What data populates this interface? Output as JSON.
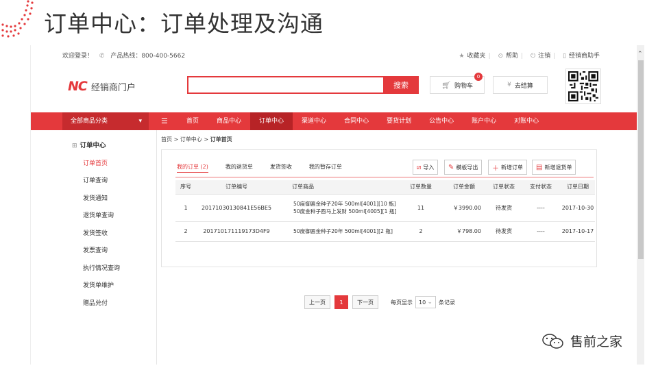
{
  "slide": {
    "title": "订单中心：订单处理及沟通"
  },
  "topbar": {
    "welcome": "欢迎登录！",
    "hotline": "产品热线：800-400-5662",
    "links": [
      "收藏夹",
      "帮助",
      "注销",
      "经销商助手"
    ]
  },
  "header": {
    "logo_mark": "NC",
    "logo_text": "经销商门户",
    "search_placeholder": "",
    "search_button": "搜索",
    "cart_label": "购物车",
    "cart_count": "0",
    "checkout_label": "去结算"
  },
  "nav": {
    "all_categories": "全部商品分类",
    "items": [
      "首页",
      "商品中心",
      "订单中心",
      "渠道中心",
      "合同中心",
      "要货计划",
      "公告中心",
      "账户中心",
      "对账中心"
    ],
    "active_index": 2
  },
  "sidebar": {
    "title": "订单中心",
    "items": [
      "订单首页",
      "订单查询",
      "发货通知",
      "退货单查询",
      "发货签收",
      "发票查询",
      "执行情况查询",
      "发货单维护",
      "赠品兑付"
    ],
    "active_index": 0
  },
  "breadcrumb": {
    "path": "首页 > 订单中心 > ",
    "current": "订单首页"
  },
  "tabs": [
    "我的订单 (2)",
    "我的退货单",
    "发货签收",
    "我的暂存订单"
  ],
  "toolbar": {
    "import": "导入",
    "template_export": "模板导出",
    "add_order": "新增订单",
    "add_return": "新增退货单"
  },
  "table": {
    "headers": [
      "序号",
      "订单编号",
      "订单商品",
      "订单数量",
      "订单金额",
      "订单状态",
      "支付状态",
      "订单日期"
    ],
    "rows": [
      {
        "no": "1",
        "code": "20171030130841E56BE5",
        "goods1": "50度御匾金种子20年 500ml[4001][10 瓶]",
        "goods2": "50度金种子酉马上发财 500ml[4005][1 瓶]",
        "qty": "11",
        "amount": "￥3990.00",
        "status": "待发货",
        "pay": "----",
        "date": "2017-10-30"
      },
      {
        "no": "2",
        "code": "201710171119173D4F9",
        "goods1": "50度御匾金种子20年 500ml[4001][2 瓶]",
        "goods2": "",
        "qty": "2",
        "amount": "￥798.00",
        "status": "待发货",
        "pay": "----",
        "date": "2017-10-17"
      }
    ]
  },
  "pager": {
    "prev": "上一页",
    "current": "1",
    "next": "下一页",
    "show_label": "每页显示",
    "page_size": "10",
    "suffix": "条记录"
  },
  "watermark": "售前之家"
}
